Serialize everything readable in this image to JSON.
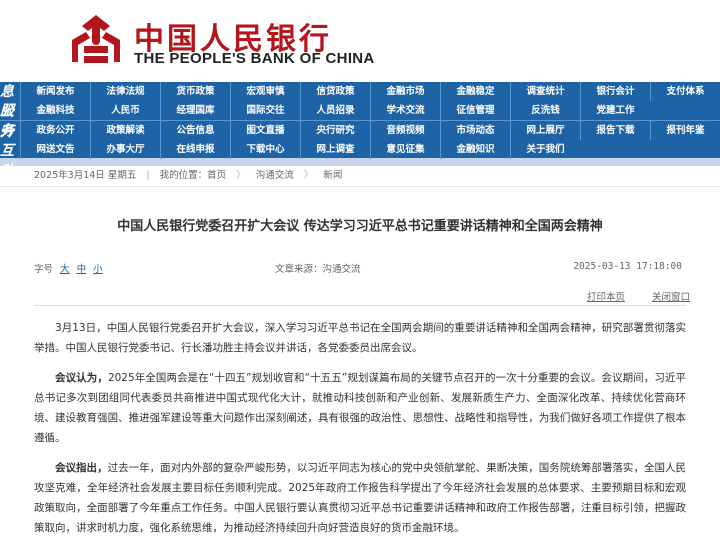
{
  "header": {
    "brand_cn": "中国人民银行",
    "brand_en": "THE PEOPLE'S BANK OF CHINA",
    "accent": "#b3161c"
  },
  "nav": {
    "bar_color": "#1e63a6",
    "section1": "信息公开",
    "section2": "服务互动",
    "rows": [
      [
        "新闻发布",
        "法律法规",
        "货币政策",
        "宏观审慎",
        "信贷政策",
        "金融市场",
        "金融稳定",
        "调查统计",
        "银行会计",
        "支付体系"
      ],
      [
        "金融科技",
        "人民币",
        "经理国库",
        "国际交往",
        "人员招录",
        "学术交流",
        "征信管理",
        "反洗钱",
        "党建工作"
      ],
      [
        "政务公开",
        "政策解读",
        "公告信息",
        "图文直播",
        "央行研究",
        "音频视频",
        "市场动态",
        "网上展厅",
        "报告下载",
        "报刊年鉴"
      ],
      [
        "网送文告",
        "办事大厅",
        "在线申报",
        "下载中心",
        "网上调查",
        "意见征集",
        "金融知识",
        "关于我们"
      ]
    ]
  },
  "breadcrumb": {
    "date": "2025年3月14日",
    "weekday": "星期五",
    "items": [
      "我的位置：首页",
      "沟通交流",
      "新闻"
    ]
  },
  "article": {
    "title": "中国人民银行党委召开扩大会议 传达学习习近平总书记重要讲话精神和全国两会精神",
    "font_label": "字号",
    "font_sizes": [
      "大",
      "中",
      "小"
    ],
    "source": "文章来源：沟通交流",
    "date": "2025-03-13 17:18:00",
    "print": "打印本页",
    "close": "关闭窗口",
    "p1": "3月13日，中国人民银行党委召开扩大会议，深入学习习近平总书记在全国两会期间的重要讲话精神和全国两会精神，研究部署贯彻落实举措。中国人民银行党委书记、行长潘功胜主持会议并讲话，各党委委员出席会议。",
    "p2_lead": "会议认为，",
    "p2": "2025年全国两会是在“十四五”规划收官和“十五五”规划谋篇布局的关键节点召开的一次十分重要的会议。会议期间，习近平总书记多次到团组同代表委员共商推进中国式现代化大计，就推动科技创新和产业创新、发展新质生产力、全面深化改革、持续优化营商环境、建设教育强国、推进强军建设等重大问题作出深刻阐述，具有很强的政治性、思想性、战略性和指导性，为我们做好各项工作提供了根本遵循。",
    "p3_lead": "会议指出，",
    "p3": "过去一年，面对内外部的复杂严峻形势，以习近平同志为核心的党中央领航掌舵、果断决策，国务院统筹部署落实，全国人民攻坚克难，全年经济社会发展主要目标任务顺利完成。2025年政府工作报告科学提出了今年经济社会发展的总体要求、主要预期目标和宏观政策取向，全面部署了今年重点工作任务。中国人民银行要认真贯彻习近平总书记重要讲话精神和政府工作报告部署，注重目标引领，把握政策取向，讲求时机力度，强化系统思维，为推动经济持续回升向好营造良好的货币金融环境。"
  }
}
